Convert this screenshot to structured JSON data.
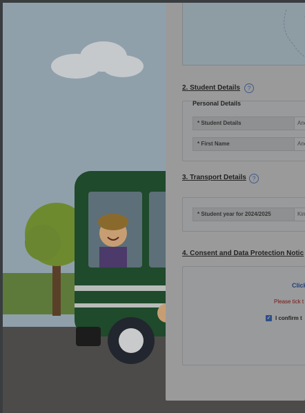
{
  "form": {
    "section2": {
      "number_title": "2. Student Details",
      "help_icon": "?",
      "personal_heading": "Personal Details",
      "fields": [
        {
          "label": "* Student Details",
          "value": "Ane"
        },
        {
          "label": "* First Name",
          "value": "Ane"
        }
      ]
    },
    "section3": {
      "number_title": "3. Transport Details",
      "help_icon": "?",
      "fields": [
        {
          "label": "* Student year for 2024/2025",
          "value": "Kin"
        }
      ]
    },
    "section4": {
      "number_title": "4. Consent and Data Protection Notic",
      "click_text": "Click",
      "warning_text": "Please tick t",
      "confirm_text": "I confirm t",
      "checkbox_checked": true
    }
  },
  "colors": {
    "overlay": "#3a3d40",
    "link": "#22407a",
    "warning": "#7a1414",
    "checkbox": "#2f4f86"
  },
  "icons": {
    "help": "question-circle-icon",
    "check": "checkmark-icon"
  }
}
